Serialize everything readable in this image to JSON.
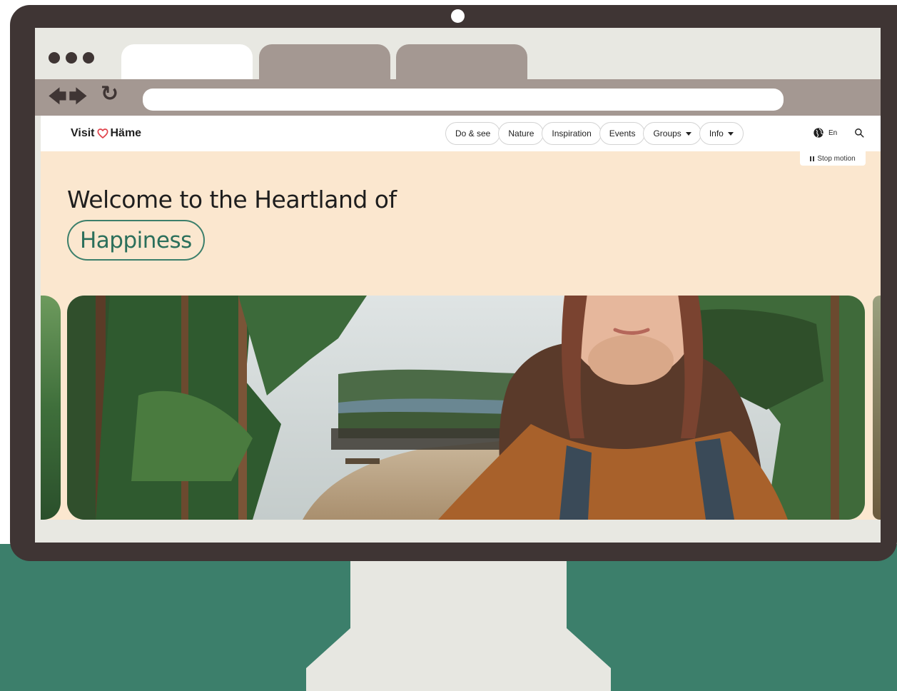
{
  "browser": {
    "url": ""
  },
  "site": {
    "logo": {
      "prefix": "Visit",
      "suffix": "Häme"
    },
    "nav": [
      {
        "label": "Do & see",
        "dropdown": false
      },
      {
        "label": "Nature",
        "dropdown": false
      },
      {
        "label": "Inspiration",
        "dropdown": false
      },
      {
        "label": "Events",
        "dropdown": false
      },
      {
        "label": "Groups",
        "dropdown": true
      },
      {
        "label": "Info",
        "dropdown": true
      }
    ],
    "language": "En",
    "stop_motion": "Stop motion",
    "hero": {
      "line1": "Welcome to the Heartland of",
      "highlight": "Happiness"
    }
  },
  "colors": {
    "bezel": "#3f3534",
    "tab_inactive": "#a49892",
    "hero_bg": "#fbe7cf",
    "accent_green": "#3c7f6b",
    "heart_red": "#e0424b"
  },
  "icons": [
    "back-arrow-icon",
    "forward-arrow-icon",
    "reload-icon",
    "heart-icon",
    "caret-down-icon",
    "globe-icon",
    "search-icon",
    "pause-icon"
  ]
}
